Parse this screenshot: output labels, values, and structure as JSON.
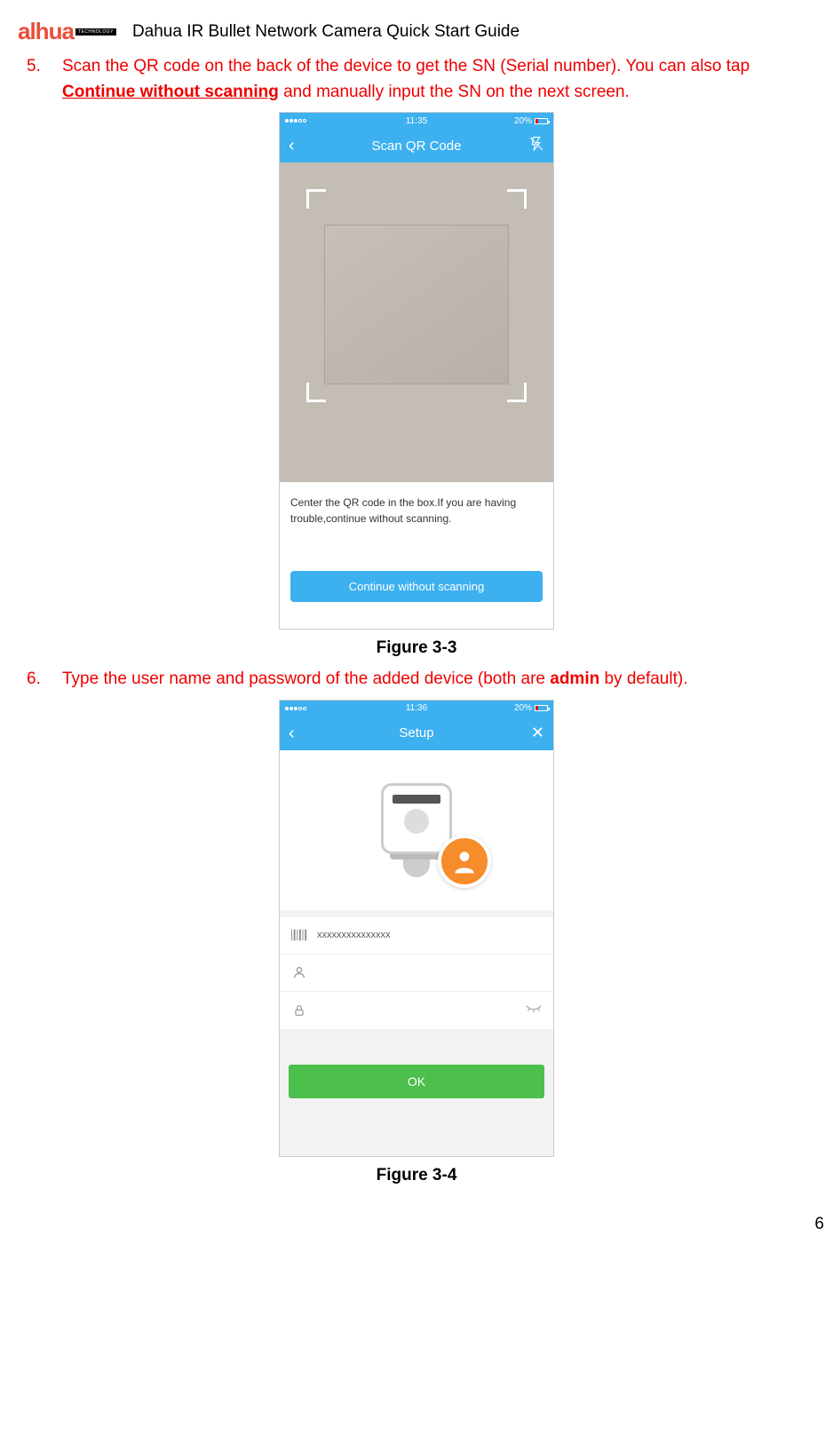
{
  "header": {
    "logo_brand": "alhua",
    "logo_sub": "TECHNOLOGY",
    "title": "Dahua IR Bullet Network Camera Quick Start Guide"
  },
  "step5": {
    "num": "5.",
    "text_a": "Scan the QR code on the back of the device to get the SN (Serial number). You can also tap ",
    "text_bold": "Continue without scanning",
    "text_b": " and manually input the SN on the next screen."
  },
  "figure3_3": {
    "caption": "Figure 3-3",
    "status_time": "11:35",
    "battery_pct": "20%",
    "nav_title": "Scan QR Code",
    "instruction": "Center the QR code in the box.If you are having trouble,continue without scanning.",
    "button": "Continue without scanning"
  },
  "step6": {
    "num": "6.",
    "text_a": "Type the user name and password of the added device (both are ",
    "text_bold": "admin",
    "text_b": " by default)."
  },
  "figure3_4": {
    "caption": "Figure 3-4",
    "status_time": "11:36",
    "battery_pct": "20%",
    "nav_title": "Setup",
    "sn_value": "xxxxxxxxxxxxxxx",
    "ok_button": "OK"
  },
  "page_number": "6"
}
